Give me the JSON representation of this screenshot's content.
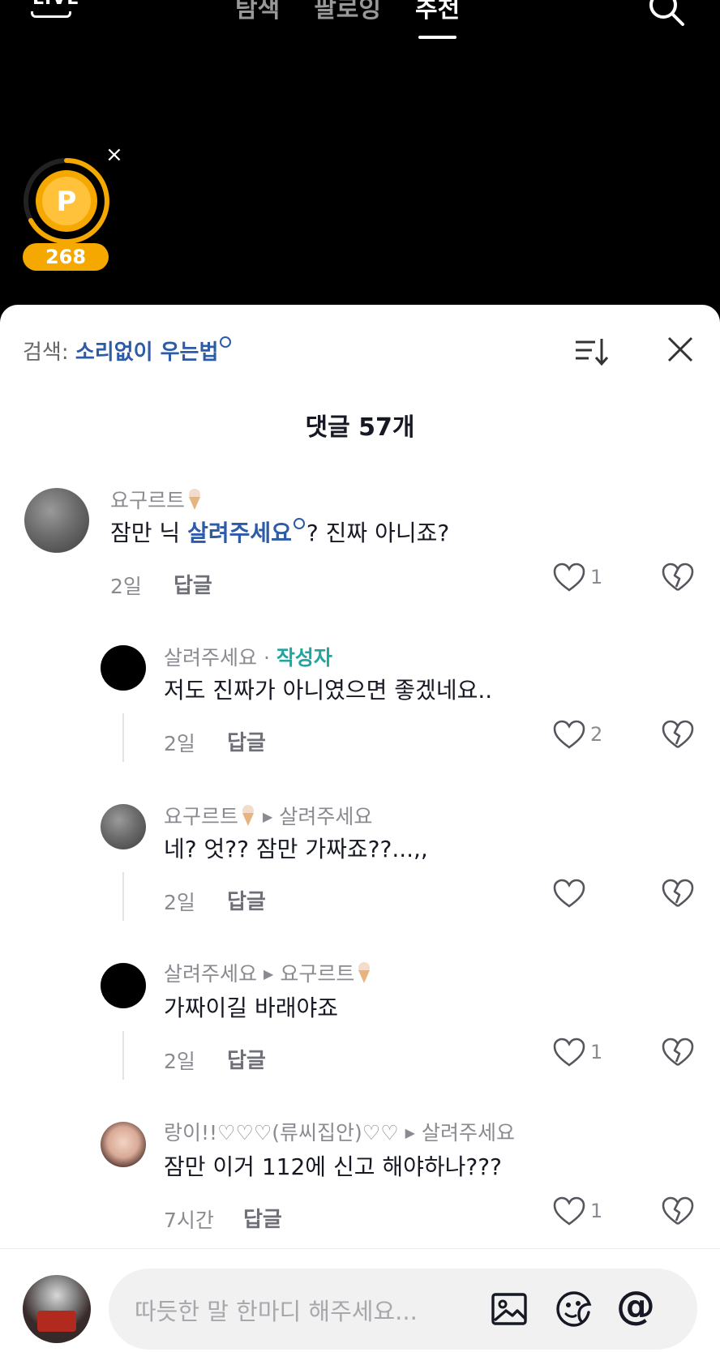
{
  "topbar": {
    "live_label": "LIVE",
    "tabs": [
      {
        "label": "탐색"
      },
      {
        "label": "팔로잉"
      },
      {
        "label": "추천"
      }
    ]
  },
  "coin": {
    "count": "268",
    "close_label": "×",
    "coin_letter": "P"
  },
  "sheet": {
    "search_label": "검색: ",
    "search_keyword": "소리없이 우는법",
    "title": "댓글 57개"
  },
  "comments": [
    {
      "user": "요구르트",
      "text_before": "잠만 닉 ",
      "text_link": "살려주세요",
      "text_after": "? 진짜 아니죠?",
      "time": "2일",
      "reply": "답글",
      "likes": "1"
    },
    {
      "user": "살려주세요",
      "separator": " · ",
      "author_tag": "작성자",
      "text": "저도 진짜가 아니였으면 좋겠네요..",
      "time": "2일",
      "reply": "답글",
      "likes": "2"
    },
    {
      "user": "요구르트",
      "reply_to": "살려주세요",
      "text": "네? 엇?? 잠만 가짜죠??...,,",
      "time": "2일",
      "reply": "답글",
      "likes": ""
    },
    {
      "user": "살려주세요",
      "reply_to": "요구르트",
      "text": "가짜이길 바래야죠",
      "time": "2일",
      "reply": "답글",
      "likes": "1"
    },
    {
      "user": "랑이!!♡♡♡(류씨집안)♡♡",
      "reply_to": "살려주세요",
      "text": "잠만 이거 112에 신고 해야하나???",
      "time": "7시간",
      "reply": "답글",
      "likes": "1"
    }
  ],
  "input": {
    "placeholder": "따듯한 말 한마디 해주세요...",
    "mention_symbol": "@"
  },
  "colors": {
    "link": "#2e5ba7",
    "author": "#20a59f",
    "coin": "#f5a800"
  }
}
